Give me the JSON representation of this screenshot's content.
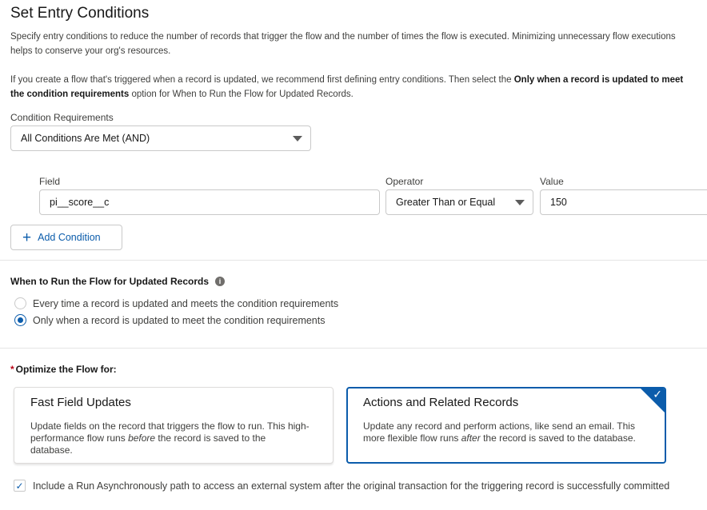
{
  "page": {
    "title": "Set Entry Conditions",
    "description_1": "Specify entry conditions to reduce the number of records that trigger the flow and the number of times the flow is executed. Minimizing unnecessary flow executions helps to conserve your org's resources.",
    "description_2_pre": "If you create a flow that's triggered when a record is updated, we recommend first defining entry conditions. Then select the ",
    "description_2_bold": "Only when a record is updated to meet the condition requirements",
    "description_2_post": " option for When to Run the Flow for Updated Records."
  },
  "condition_requirements": {
    "label": "Condition Requirements",
    "selected": "All Conditions Are Met (AND)"
  },
  "condition_row": {
    "field_label": "Field",
    "field_value": "pi__score__c",
    "operator_label": "Operator",
    "operator_value": "Greater Than or Equal",
    "value_label": "Value",
    "value_value": "150"
  },
  "add_condition_label": "Add Condition",
  "when_to_run": {
    "title": "When to Run the Flow for Updated Records",
    "options": [
      {
        "label": "Every time a record is updated and meets the condition requirements",
        "checked": false
      },
      {
        "label": "Only when a record is updated to meet the condition requirements",
        "checked": true
      }
    ]
  },
  "optimize": {
    "required_marker": "*",
    "title": "Optimize the Flow for:",
    "cards": [
      {
        "title": "Fast Field Updates",
        "desc_pre": "Update fields on the record that triggers the flow to run. This high-performance flow runs ",
        "desc_em": "before",
        "desc_post": " the record is saved to the database.",
        "selected": false
      },
      {
        "title": "Actions and Related Records",
        "desc_pre": "Update any record and perform actions, like send an email. This more flexible flow runs ",
        "desc_em": "after",
        "desc_post": " the record is saved to the database.",
        "selected": true
      }
    ]
  },
  "async_option": {
    "label": "Include a Run Asynchronously path to access an external system after the original transaction for the triggering record is successfully committed",
    "checked": true
  },
  "icons": {
    "caret": "chevron-down-icon",
    "info": "info-icon",
    "plus": "plus-icon",
    "check": "check-icon"
  },
  "colors": {
    "brand": "#0b5cab",
    "required": "#ba0517",
    "border": "#c9c9c9"
  }
}
